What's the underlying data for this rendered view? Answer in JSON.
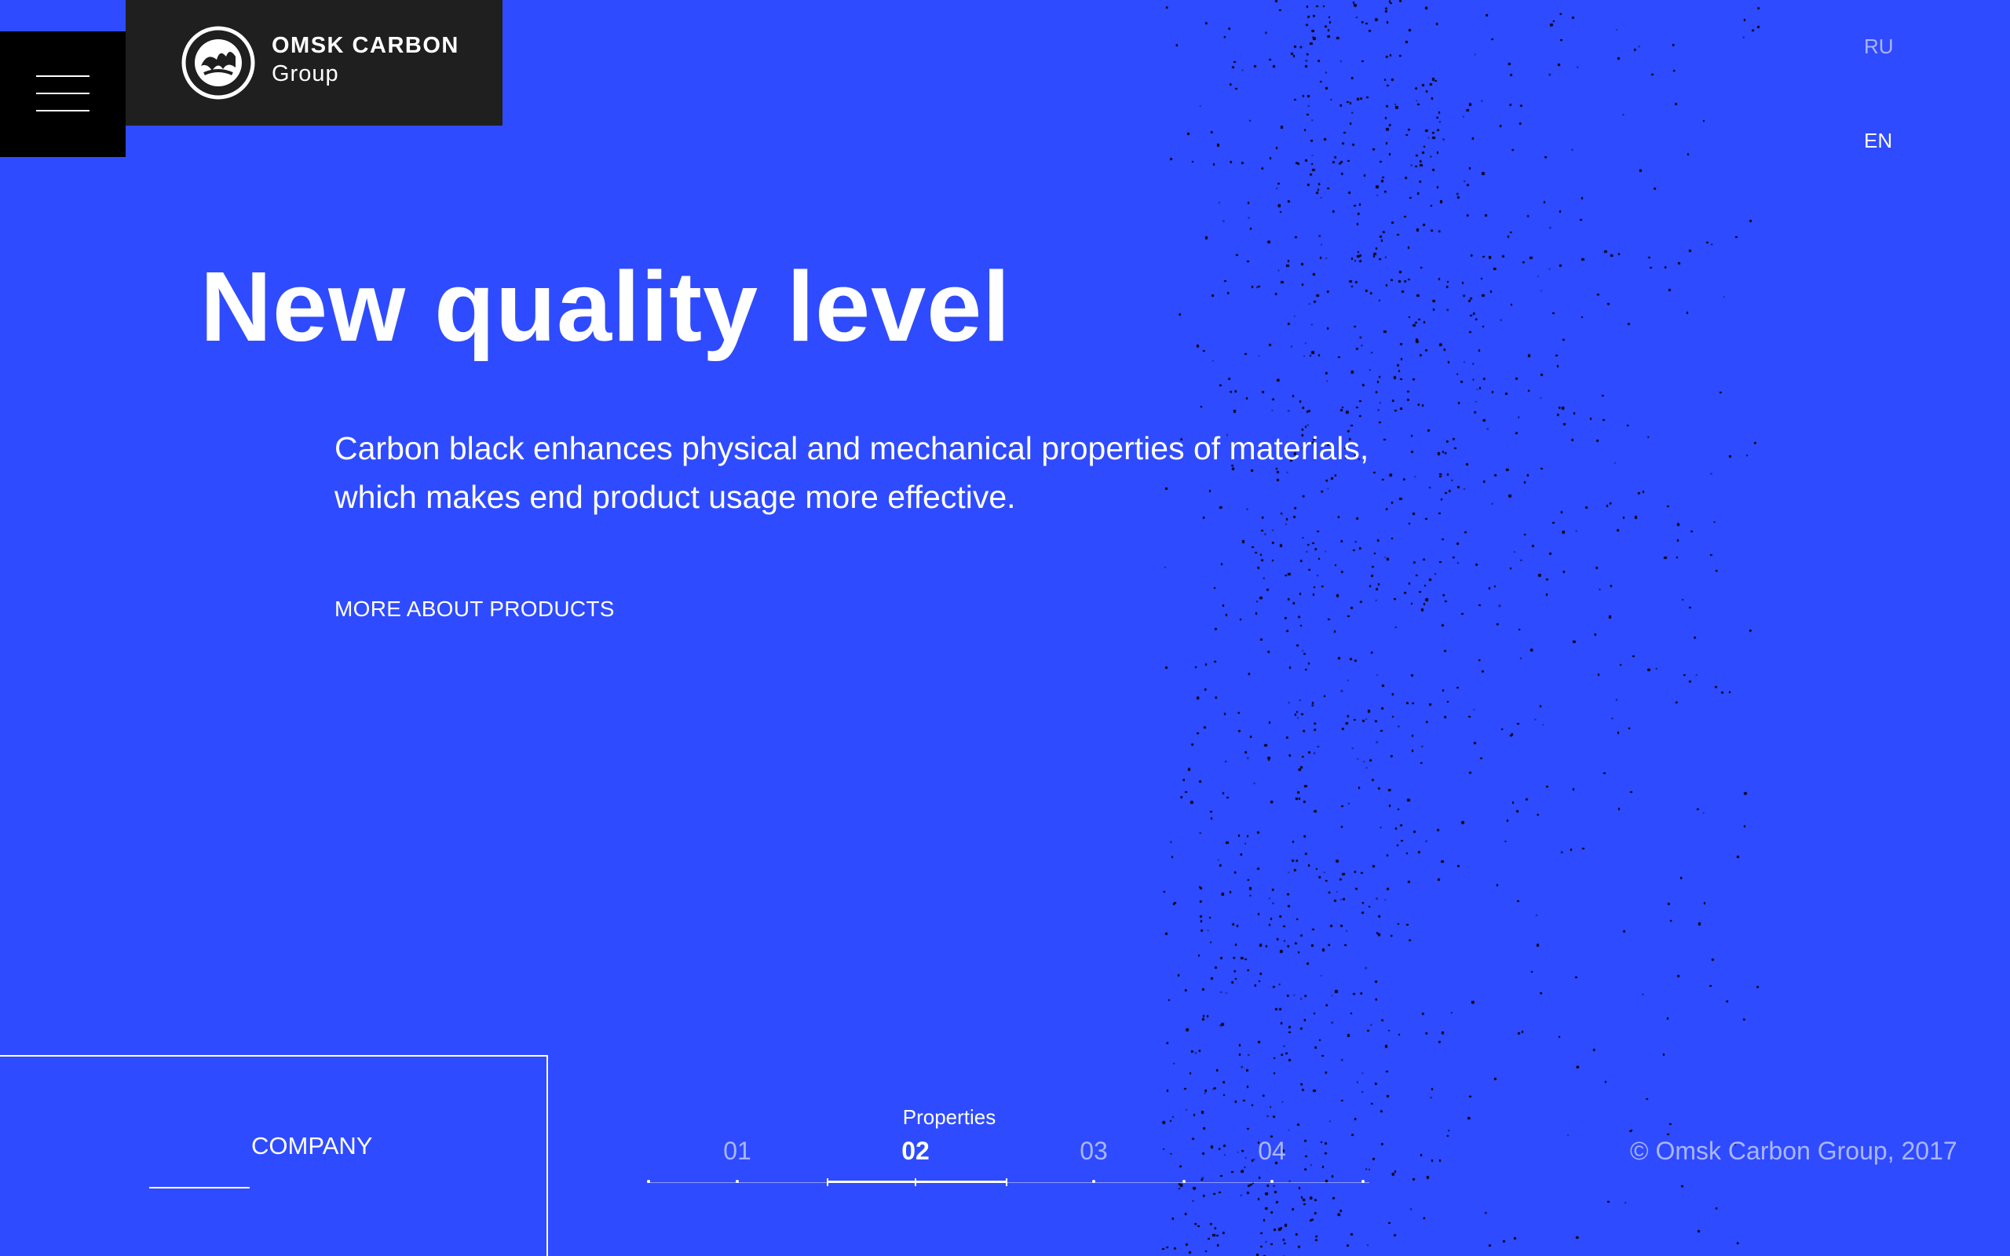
{
  "brand": {
    "name_line1": "OMSK CARBON",
    "name_line2": "Group",
    "logo_icon": "omsk-carbon-logo"
  },
  "header": {
    "menu_icon": "hamburger-menu-icon",
    "languages": [
      {
        "code": "RU",
        "active": false
      },
      {
        "code": "EN",
        "active": true
      }
    ]
  },
  "hero": {
    "headline": "New quality level",
    "description": "Carbon black enhances physical and mechanical properties of materials, which makes end product usage more effective.",
    "cta_label": "MORE ABOUT PRODUCTS"
  },
  "footer": {
    "company_label": "COMPANY",
    "copyright": "© Omsk Carbon Group, 2017"
  },
  "slides": {
    "active_index": 1,
    "active_caption": "Properties",
    "items": [
      "01",
      "02",
      "03",
      "04"
    ]
  },
  "colors": {
    "background": "#2f4bff",
    "logo_panel": "#1f1f1f",
    "menu_panel": "#000000",
    "muted_text": "#aab6ff",
    "particles": "#000000"
  }
}
